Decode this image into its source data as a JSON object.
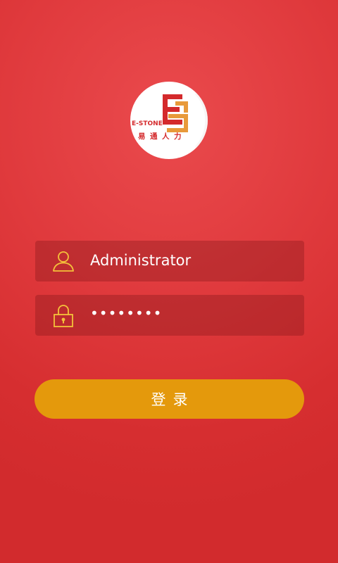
{
  "logo": {
    "brand": "E-STONE",
    "subtitle": "易通人力",
    "colors": {
      "circle": "#ffffff",
      "red": "#d42a2c",
      "orange": "#e89a3a"
    }
  },
  "form": {
    "username": {
      "icon": "user-icon",
      "value": "Administrator"
    },
    "password": {
      "icon": "lock-icon",
      "value": "••••••••"
    },
    "login_label": "登录"
  },
  "colors": {
    "background": "#dc3436",
    "field_background": "#a9282b",
    "icon_accent": "#f4c13a",
    "button": "#e4990c",
    "text": "#ffffff"
  }
}
